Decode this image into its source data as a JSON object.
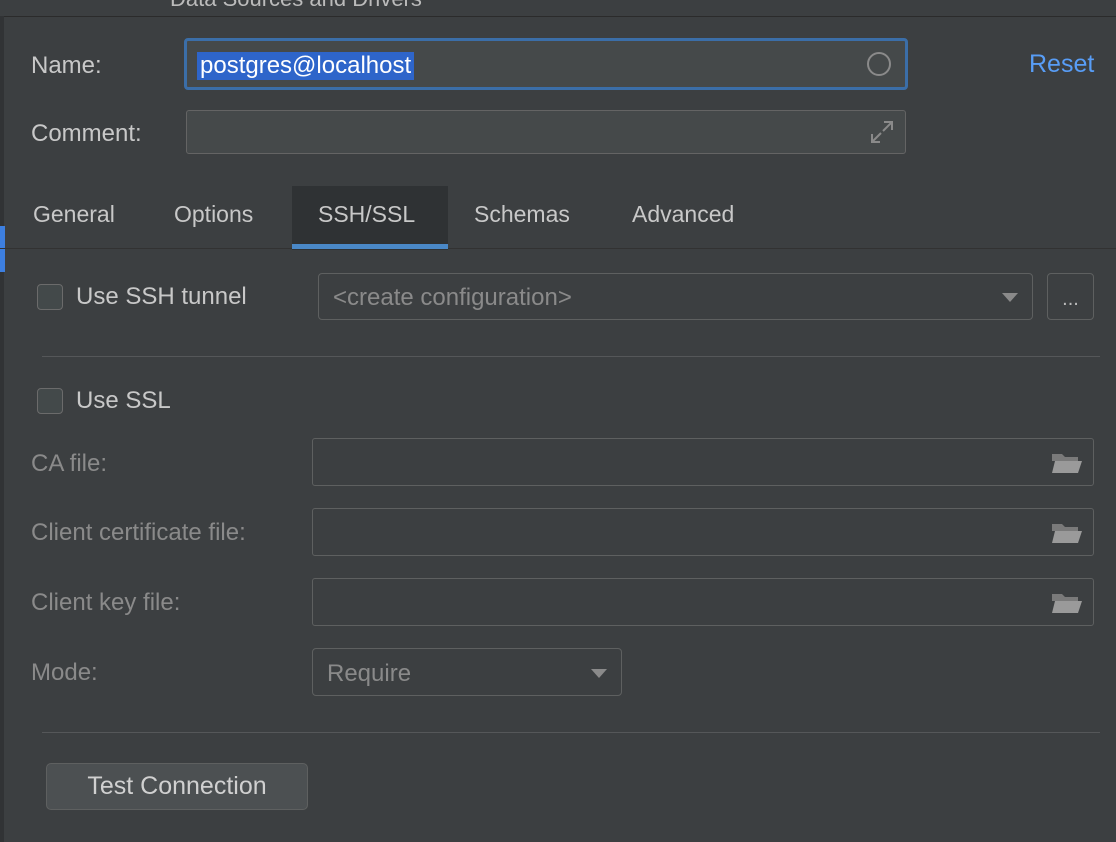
{
  "window": {
    "title": "Data Sources and Drivers"
  },
  "header": {
    "name_label": "Name:",
    "name_value": "postgres@localhost",
    "reset_label": "Reset",
    "comment_label": "Comment:",
    "comment_value": ""
  },
  "tabs": [
    {
      "label": "General",
      "active": false
    },
    {
      "label": "Options",
      "active": false
    },
    {
      "label": "SSH/SSL",
      "active": true
    },
    {
      "label": "Schemas",
      "active": false
    },
    {
      "label": "Advanced",
      "active": false
    }
  ],
  "ssh": {
    "use_ssh_label": "Use SSH tunnel",
    "use_ssh_checked": false,
    "configuration_value": "<create configuration>",
    "more_button_label": "..."
  },
  "ssl": {
    "use_ssl_label": "Use SSL",
    "use_ssl_checked": false,
    "ca_file_label": "CA file:",
    "ca_file_value": "",
    "client_cert_label": "Client certificate file:",
    "client_cert_value": "",
    "client_key_label": "Client key file:",
    "client_key_value": "",
    "mode_label": "Mode:",
    "mode_value": "Require"
  },
  "footer": {
    "test_connection_label": "Test Connection"
  },
  "colors": {
    "background": "#3c3f41",
    "accent": "#4a88c7",
    "link": "#589df6",
    "selection": "#2e65ca"
  }
}
